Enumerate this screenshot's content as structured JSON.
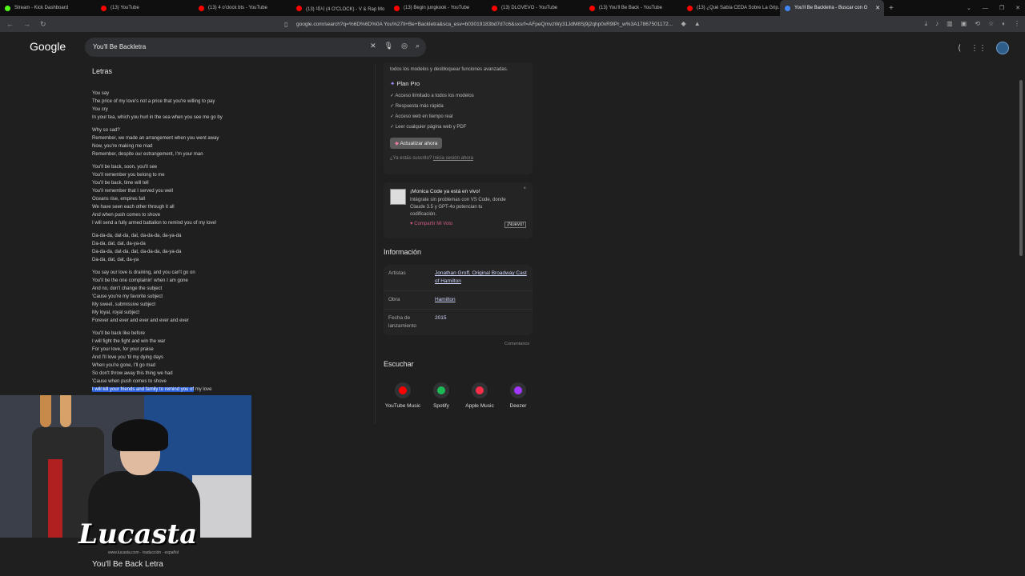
{
  "tabs": [
    {
      "title": "Stream - Kick Dashboard",
      "color": "#53fc18",
      "width": 120
    },
    {
      "title": "(13) YouTube",
      "color": "#ff0000",
      "width": 122
    },
    {
      "title": "(13) 4 o'clock bts - YouTube",
      "color": "#ff0000",
      "width": 122
    },
    {
      "title": "(13) 네시 (4 O'CLOCK) - V & Rap Mo",
      "color": "#ff0000",
      "width": 122
    },
    {
      "title": "(13) Begin jungkook - YouTube",
      "color": "#ff0000",
      "width": 122
    },
    {
      "title": "(13) DLGVEVO - YouTube",
      "color": "#ff0000",
      "width": 122
    },
    {
      "title": "(13) You'll Be Back - YouTube",
      "color": "#ff0000",
      "width": 122
    },
    {
      "title": "(13) ¿Qué Sabía CEDA Sobre La Grip...",
      "color": "#ff0000",
      "width": 122
    },
    {
      "title": "You'll Be Backletra - Buscar con G",
      "color": "#4285f4",
      "width": 130,
      "active": true
    }
  ],
  "address_bar": {
    "url": "google.com/search?q=%6D%6D%0A You%27ll+Be+Backletra&sca_esv=b03019183bd7d7c6&sxsrf=AFpeQmvzWy31JdM8Sj9j2qhp0xR9lPr_w%3A17867501172..."
  },
  "google": {
    "logo": "Google",
    "search_value": "You'll Be Backletra"
  },
  "lyrics": {
    "title": "Letras",
    "stanzas": [
      [
        "You say",
        "The price of my love's not a price that you're willing to pay",
        "You cry",
        "In your tea, which you hurl in the sea when you see me go by"
      ],
      [
        "Why so sad?",
        "Remember, we made an arrangement when you went away",
        "Now, you're making me mad",
        "Remember, despite our estrangement, I'm your man"
      ],
      [
        "You'll be back, soon, you'll see",
        "You'll remember you belong to me",
        "You'll be back, time will tell",
        "You'll remember that I served you well",
        "Oceans rise, empires fall",
        "We have seen each other through it all",
        "And when push comes to shove",
        "I will send a fully armed battalion to remind you of my love!"
      ],
      [
        "Da-da-da, dat-da, dat, da-da-da, da-ya-da",
        "Da-da, dat, dat, da-ya-da",
        "Da-da-da, dat-da, dat, da-da-da, da-ya-da",
        "Da-da, dat, dat, da-ya"
      ],
      [
        "You say our love is draining, and you can't go on",
        "You'll be the one complainin' when I am gone",
        "And no, don't change the subject",
        "'Cause you're my favorite subject",
        "My sweet, submissive subject",
        "My loyal, royal subject",
        "Forever and ever and ever and ever and ever"
      ],
      [
        "You'll be back like before",
        "I will fight the fight and win the war",
        "For your love, for your praise",
        "And I'll love you 'til my dying days",
        "When you're gone, I'll go mad",
        "So don't throw away this thing we had",
        "'Cause when push comes to shove"
      ]
    ],
    "last_line_highlighted": "I will kill your friends and family to remind you of",
    "last_line_rest": " my love"
  },
  "promo": {
    "intro": "todos los modelos y desbloquear funciones avanzadas.",
    "plan_name": "Plan Pro",
    "features": [
      "Acceso ilimitado a todos los modelos",
      "Respuesta más rápida",
      "Acceso web en tiempo real",
      "Leer cualquier página web y PDF"
    ],
    "button": "Actualizar ahora",
    "login_prefix": "¿Ya estás suscrito? ",
    "login_link": "Inicia sesión ahora"
  },
  "monica": {
    "title": "¡Monica Code ya está en vivo!",
    "lines": [
      "Intégrate sin problemas con VS Code, donde",
      "Claude 3.5 y GPT-4o potencian tu",
      "codificación."
    ],
    "share": "Compartir Mi Voto",
    "new_badge": "¡Nuevo!",
    "close": "×"
  },
  "info": {
    "title": "Información",
    "rows": [
      {
        "key": "Artistas",
        "value": "Jonathan Groff, Original Broadway Cast of Hamilton",
        "link": true
      },
      {
        "key": "Obra",
        "value": "Hamilton",
        "link": true
      },
      {
        "key": "Fecha de lanzamiento",
        "value": "2015",
        "link": false
      }
    ],
    "comments": "Comentarios"
  },
  "listen": {
    "title": "Escuchar",
    "platforms": [
      {
        "name": "YouTube Music",
        "color": "#ff0000",
        "icon": "youtube-music-icon"
      },
      {
        "name": "Spotify",
        "color": "#1db954",
        "icon": "spotify-icon"
      },
      {
        "name": "Apple Music",
        "color": "#fa2d48",
        "icon": "apple-music-icon"
      },
      {
        "name": "Deezer",
        "color": "#a238ff",
        "icon": "deezer-icon"
      }
    ]
  },
  "overlay": {
    "brand": "Lucasta",
    "watermark": "www.lucasta.com · traducción · español",
    "bottom_title": "You'll Be Back Letra"
  }
}
